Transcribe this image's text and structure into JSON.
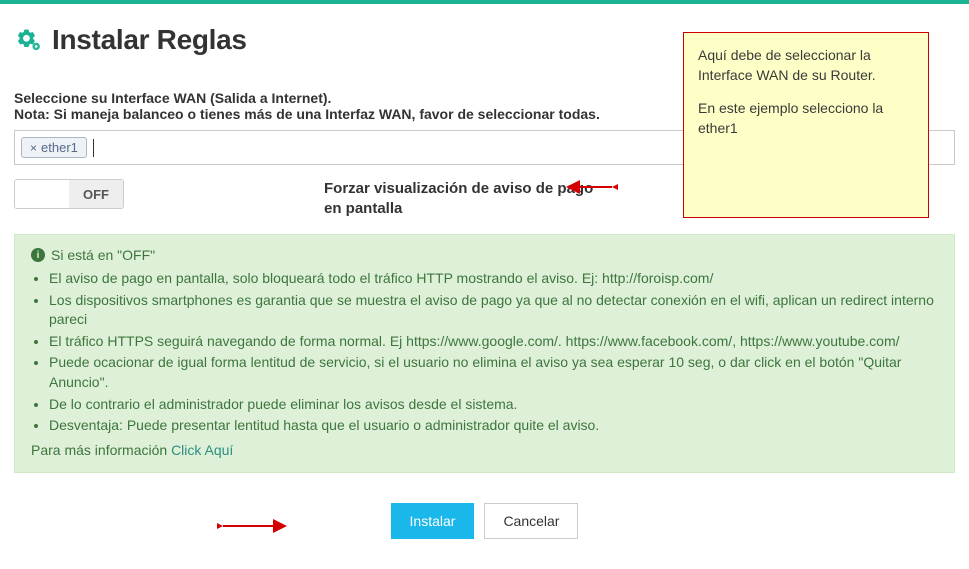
{
  "page": {
    "title": "Instalar Reglas"
  },
  "wan": {
    "label_line1": "Seleccione su Interface WAN (Salida a Internet).",
    "label_line2": "Nota: Si maneja balanceo o tienes más de una Interfaz WAN, favor de seleccionar todas.",
    "selected": [
      "ether1"
    ]
  },
  "toggle": {
    "state": "OFF",
    "label": "Forzar visualización de aviso de pago en pantalla"
  },
  "alert": {
    "heading": "Si está en \"OFF\"",
    "bullets": [
      "El aviso de pago en pantalla, solo bloqueará todo el tráfico HTTP mostrando el aviso. Ej: http://foroisp.com/",
      "Los dispositivos smartphones es garantia que se muestra el aviso de pago ya que al no detectar conexión en el wifi, aplican un redirect interno pareci",
      "El tráfico HTTPS seguirá navegando de forma normal. Ej https://www.google.com/. https://www.facebook.com/, https://www.youtube.com/",
      "Puede ocacionar de igual forma lentitud de servicio, si el usuario no elimina el aviso ya sea esperar 10 seg, o dar click en el botón \"Quitar Anuncio\".",
      "De lo contrario el administrador puede eliminar los avisos desde el sistema.",
      "Desventaja: Puede presentar lentitud hasta que el usuario o administrador quite el aviso."
    ],
    "footer_prefix": "Para más información ",
    "footer_link": "Click Aquí"
  },
  "buttons": {
    "install": "Instalar",
    "cancel": "Cancelar"
  },
  "note": {
    "p1": "Aquí debe de seleccionar la Interface WAN  de su Router.",
    "p2": "En este ejemplo selecciono la ether1"
  }
}
